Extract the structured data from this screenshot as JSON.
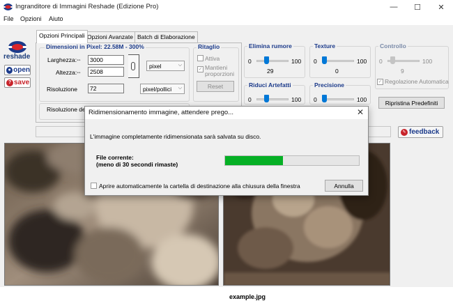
{
  "window": {
    "title": "Ingranditore di Immagini Reshade (Edizione Pro)",
    "minimize": "—",
    "maximize": "☐",
    "close": "✕"
  },
  "menu": [
    "File",
    "Opzioni",
    "Aiuto"
  ],
  "sidebar": {
    "logo_text": "reshade",
    "open_label": "open",
    "save_label": "save"
  },
  "tabs": [
    "Opzioni Principali",
    "Opzioni Avanzate",
    "Batch di Elaborazione"
  ],
  "dimensions": {
    "title": "Dimensioni in Pixel:  22.58M - 300%",
    "width_label": "Larghezza:",
    "width_value": "3000",
    "height_label": "Altezza:",
    "height_value": "2508",
    "unit": "pixel",
    "resolution_label": "Risoluzione",
    "resolution_value": "72",
    "resolution_unit": "pixel/pollici",
    "resolution_row_label": "Risoluzione dell"
  },
  "crop": {
    "title": "Ritaglio",
    "active_label": "Attiva",
    "keep_label_1": "Mantieni",
    "keep_label_2": "proporzioni",
    "reset_label": "Reset"
  },
  "noise": {
    "title": "Elimina rumore",
    "min": "0",
    "max": "100",
    "value": "29",
    "fraction": 0.29
  },
  "texture": {
    "title": "Texture",
    "min": "0",
    "max": "100",
    "value": "0",
    "fraction": 0.0
  },
  "control": {
    "title": "Controllo",
    "min": "0",
    "max": "100",
    "value": "9",
    "fraction": 0.09,
    "auto_label": "Regolazione Automatica"
  },
  "artifacts": {
    "title": "Riduci Artefatti",
    "min": "0",
    "max": "100",
    "fraction": 0.29
  },
  "precision": {
    "title": "Precisione",
    "min": "0",
    "max": "100",
    "fraction": 0.0
  },
  "restore_label": "Ripristina Predefiniti",
  "feedback_label": "feedback",
  "status": {
    "filename": "example.jpg"
  },
  "dialog": {
    "title": "Ridimensionamento immagine, attendere prego...",
    "message": "L'immagine completamente ridimensionata sarà salvata su disco.",
    "current_file_label": "File corrente:",
    "time_remaining": "(meno di 30 secondi rimaste)",
    "progress": 0.43,
    "open_folder_label": "Aprire automaticamente la cartella di destinazione alla chiusura della finestra",
    "cancel_label": "Annulla"
  },
  "colors": {
    "accent": "#1b3a8a",
    "progress": "#06b025",
    "slider": "#0078d7"
  }
}
